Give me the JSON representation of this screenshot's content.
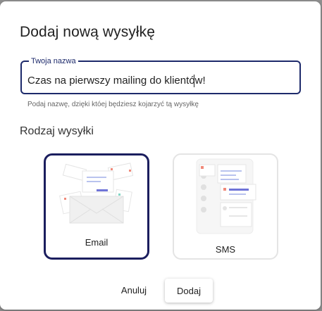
{
  "dialog": {
    "title": "Dodaj nową wysyłkę",
    "name_field": {
      "label": "Twoja nazwa",
      "value": "Czas na pierwszy mailing do klientów!"
    },
    "helper": "Podaj nazwę, dzięki któej będziesz kojarzyć tą wysyłkę",
    "section_title": "Rodzaj wysyłki",
    "types": [
      {
        "label": "Email",
        "icon": "email-illustration-icon",
        "selected": true
      },
      {
        "label": "SMS",
        "icon": "sms-illustration-icon",
        "selected": false
      }
    ],
    "cancel_label": "Anuluj",
    "add_label": "Dodaj"
  },
  "colors": {
    "accent": "#1d2a6b",
    "selected_border": "#1b1e5e",
    "backdrop": "#8f8f8f"
  }
}
